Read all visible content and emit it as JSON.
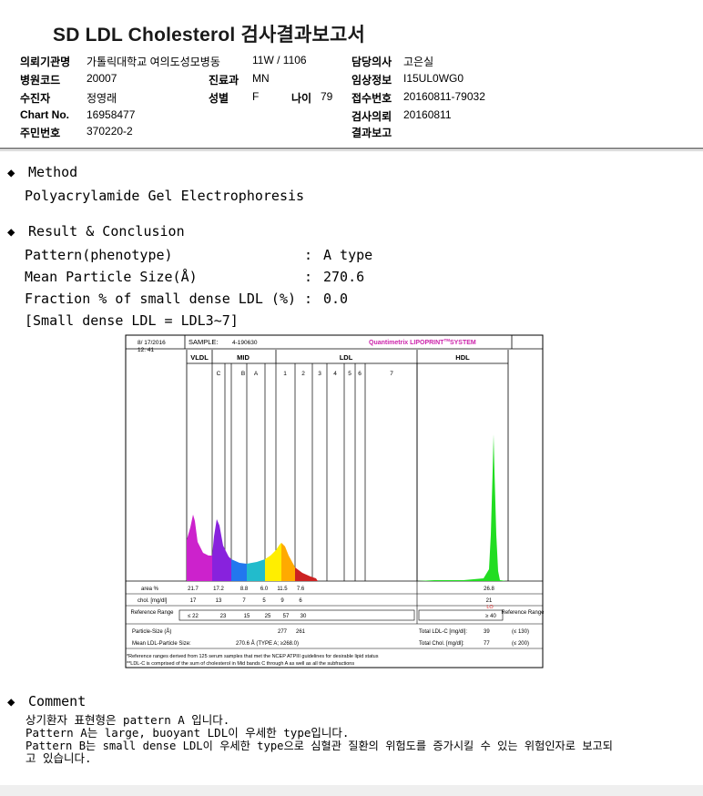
{
  "report": {
    "title": "SD LDL Cholesterol 검사결과보고서",
    "fields": {
      "institution_label": "의뢰기관명",
      "institution_value": "가톨릭대학교 여의도성모병동",
      "ward_value": "11W / 1106",
      "doctor_label": "담당의사",
      "doctor_value": "고은실",
      "hospital_code_label": "병원코드",
      "hospital_code_value": "20007",
      "dept_label": "진료과",
      "dept_value": "MN",
      "clinical_label": "임상정보",
      "clinical_value": "I15UL0WG0",
      "patient_label": "수진자",
      "patient_value": "정영래",
      "sex_label": "성별",
      "sex_value": "F",
      "age_label": "나이",
      "age_value": "79",
      "receipt_label": "접수번호",
      "receipt_value": "20160811-79032",
      "chart_label": "Chart No.",
      "chart_value": "16958477",
      "request_label": "검사의뢰",
      "request_value": "20160811",
      "id_label": "주민번호",
      "id_value": "370220-2",
      "report_label": "결과보고",
      "report_value": ""
    },
    "method": {
      "heading": "Method",
      "text": "Polyacrylamide Gel Electrophoresis"
    },
    "result": {
      "heading": "Result & Conclusion",
      "rows": [
        {
          "label": "Pattern(phenotype)",
          "value": "A type"
        },
        {
          "label": "Mean Particle Size(Å)",
          "value": "270.6"
        },
        {
          "label": "Fraction % of small dense LDL (%)",
          "value": "0.0"
        }
      ],
      "colon": ":",
      "note": "[Small dense LDL = LDL3~7]"
    },
    "comment": {
      "heading": "Comment",
      "line1": "상기환자 표현형은 pattern A 입니다.",
      "line2": "Pattern A는 large, buoyant LDL이 우세한 type입니다.",
      "line3": "Pattern B는 small dense LDL이 우세한 type으로 심혈관 질환의 위험도를 증가시킬 수 있는 위험인자로 보고되",
      "line4": "고 있습니다."
    }
  },
  "chart_data": {
    "type": "area",
    "date": "8/ 17/2016",
    "time": "12: 41",
    "sample_label": "SAMPLE:",
    "sample_id": "4-190630",
    "system_name": "Quantimetrix LIPOPRINT",
    "system_tm": "TM",
    "system_suffix": "SYSTEM",
    "bands": [
      "VLDL",
      "C",
      "B",
      "A",
      "1",
      "2",
      "3",
      "4",
      "5",
      "6",
      "7"
    ],
    "group_labels": {
      "vldl": "VLDL",
      "mid": "MID",
      "ldl": "LDL",
      "hdl": "HDL"
    },
    "row_labels": {
      "area": "area %",
      "chol": "chol. [mg/dl]",
      "ref": "Reference Range",
      "size": "Particle-Size (Å)",
      "mean": "Mean LDL-Particle Size:"
    },
    "area_pct": [
      "21.7",
      "17.2",
      "8.8",
      "6.0",
      "11.5",
      "7.6"
    ],
    "chol_mgdl": [
      "17",
      "13",
      "7",
      "5",
      "9",
      "6"
    ],
    "reference": [
      "≤ 22",
      "23",
      "15",
      "25",
      "57",
      "30"
    ],
    "particle_size": [
      "277",
      "261"
    ],
    "hdl_area": "26.8",
    "hdl_chol": "21",
    "hdl_flag": "LO",
    "hdl_reference": "≥ 40",
    "reference_range_label": "Reference Range",
    "mean_size_value": "270.6 Å  (TYPE A; ≥268.0)",
    "total_ldl_label": "Total LDL-C [mg/dl]:",
    "total_ldl_value": "39",
    "total_ldl_ref": "(≤ 130)",
    "total_chol_label": "Total Chol. [mg/dl]:",
    "total_chol_value": "77",
    "total_chol_ref": "(≤ 200)",
    "footnote1": "*Reference ranges derived from 125 serum samples that met the NCEP ATPIII guidelines for desirable lipid status",
    "footnote2": "**LDL-C is comprised of the sum of cholesterol in Mid bands C through A as well as all the subfractions",
    "colors": {
      "vldl": "#cc22cc",
      "midc": "#8822dd",
      "midb": "#2277ee",
      "mida": "#22bbcc",
      "ldl1": "#ffee00",
      "ldl2": "#ffaa00",
      "ldl3": "#cc2222",
      "hdl": "#22dd22",
      "system": "#cc22aa",
      "lo": "#dd2222"
    }
  }
}
